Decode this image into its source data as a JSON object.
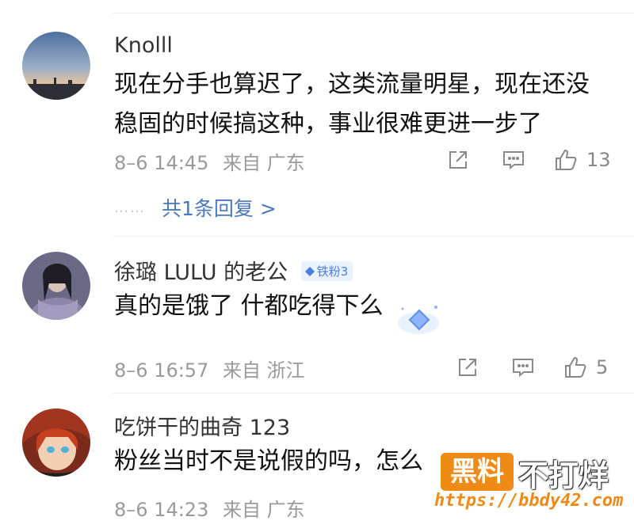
{
  "comments": [
    {
      "username": "Knolll",
      "text_line1": "现在分手也算迟了，这类流量明星，现在还没",
      "text_line2": "稳固的时候搞这种，事业很难更进一步了",
      "time": "8–6 14:45",
      "source": "来自 广东",
      "likes": "13",
      "replies_dots": "……",
      "replies_label": "共1条回复 >"
    },
    {
      "username": "徐璐 LULU 的老公",
      "badge": "铁粉3",
      "text_line1": "真的是饿了 什都吃得下么",
      "time": "8–6 16:57",
      "source": "来自 浙江",
      "likes": "5"
    },
    {
      "username": "吃饼干的曲奇 123",
      "text_line1": "粉丝当时不是说假的吗，怎么",
      "time": "8–6 14:23",
      "source": "来自 广东"
    }
  ],
  "icons": {
    "share": "share-icon",
    "comment": "comment-icon",
    "like": "thumbs-up-icon"
  },
  "watermark": {
    "logo": "黑料",
    "text": "不打烊",
    "url": "https://bbdy42.com"
  },
  "colors": {
    "reply_link": "#4a78b8",
    "meta_gray": "#9a9a9a",
    "watermark_orange": "#f08a16"
  }
}
